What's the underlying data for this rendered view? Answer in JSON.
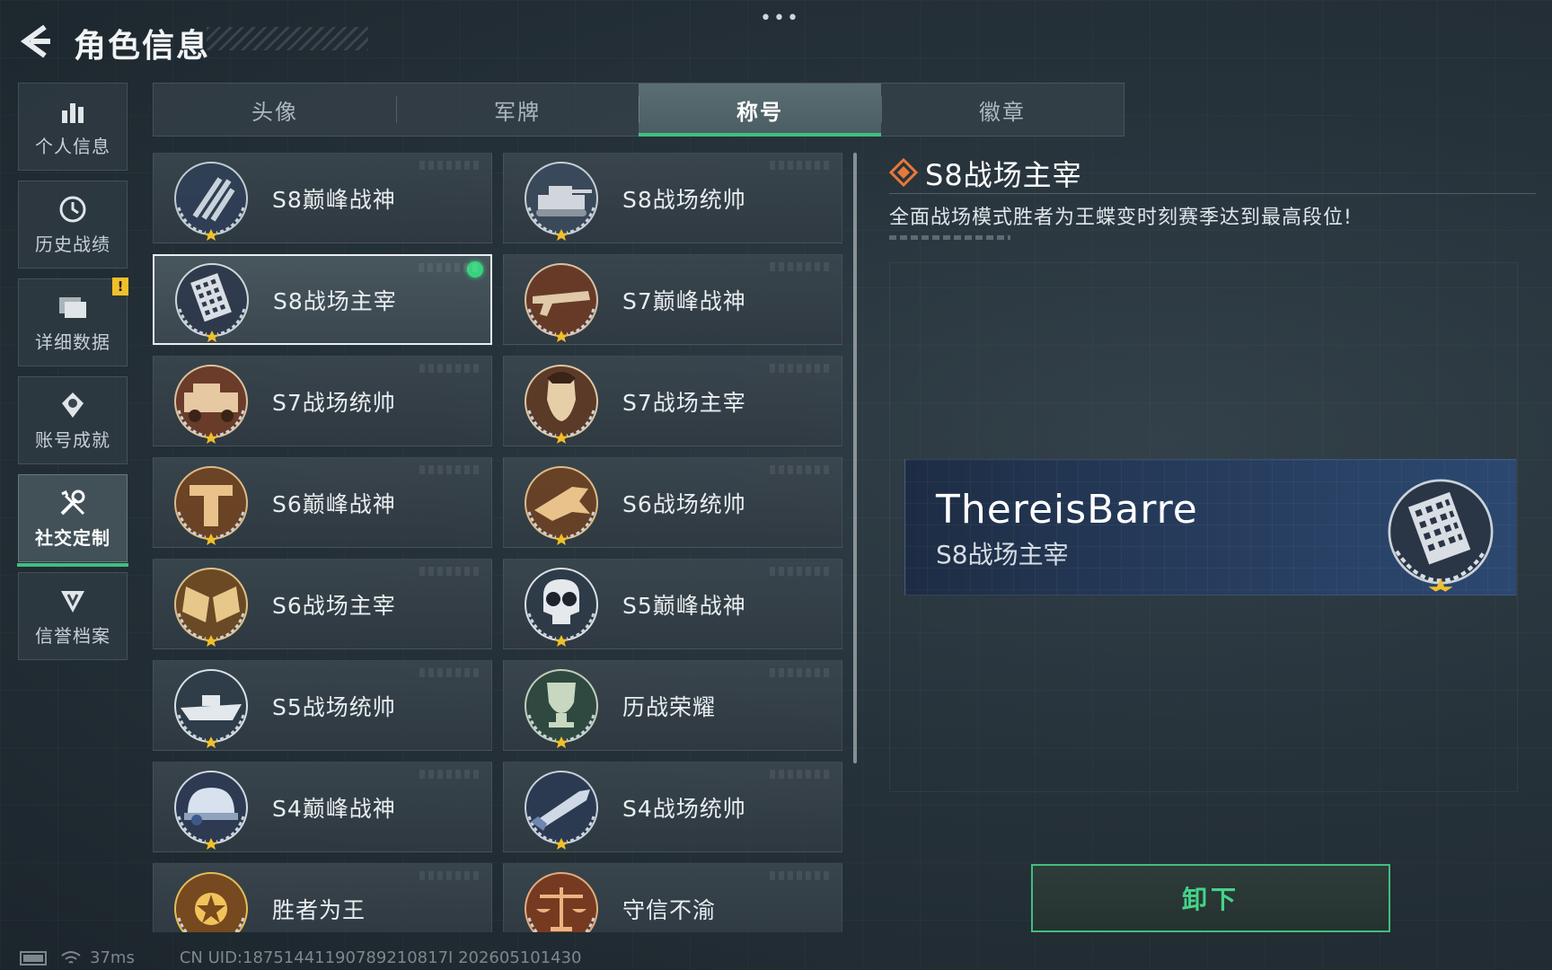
{
  "header": {
    "title": "角色信息",
    "back_icon": "back-arrow-icon",
    "more_label": "•••"
  },
  "sidebar": {
    "items": [
      {
        "label": "个人信息",
        "icon": "bar-chart-icon",
        "active": false,
        "badge": ""
      },
      {
        "label": "历史战绩",
        "icon": "clock-icon",
        "active": false,
        "badge": ""
      },
      {
        "label": "详细数据",
        "icon": "folder-icon",
        "active": false,
        "badge": "!"
      },
      {
        "label": "账号成就",
        "icon": "achievement-icon",
        "active": false,
        "badge": ""
      },
      {
        "label": "社交定制",
        "icon": "tools-icon",
        "active": true,
        "badge": ""
      },
      {
        "label": "信誉档案",
        "icon": "shield-icon",
        "active": false,
        "badge": ""
      }
    ]
  },
  "tabs": [
    {
      "label": "头像",
      "active": false
    },
    {
      "label": "军牌",
      "active": false
    },
    {
      "label": "称号",
      "active": true
    },
    {
      "label": "徽章",
      "active": false
    }
  ],
  "titles": [
    {
      "label": "S8巅峰战神",
      "emblem": "stripes-emblem",
      "selected": false,
      "equipped": false
    },
    {
      "label": "S8战场统帅",
      "emblem": "tank-emblem",
      "selected": false,
      "equipped": false
    },
    {
      "label": "S8战场主宰",
      "emblem": "building-emblem",
      "selected": true,
      "equipped": true
    },
    {
      "label": "S7巅峰战神",
      "emblem": "rifle-emblem",
      "selected": false,
      "equipped": false
    },
    {
      "label": "S7战场统帅",
      "emblem": "armored-truck-emblem",
      "selected": false,
      "equipped": false
    },
    {
      "label": "S7战场主宰",
      "emblem": "soldier-emblem",
      "selected": false,
      "equipped": false
    },
    {
      "label": "S6巅峰战神",
      "emblem": "t-emblem",
      "selected": false,
      "equipped": false
    },
    {
      "label": "S6战场统帅",
      "emblem": "jet-emblem",
      "selected": false,
      "equipped": false
    },
    {
      "label": "S6战场主宰",
      "emblem": "flags-emblem",
      "selected": false,
      "equipped": false
    },
    {
      "label": "S5巅峰战神",
      "emblem": "skull-emblem",
      "selected": false,
      "equipped": false
    },
    {
      "label": "S5战场统帅",
      "emblem": "boat-emblem",
      "selected": false,
      "equipped": false
    },
    {
      "label": "历战荣耀",
      "emblem": "trophy-emblem",
      "selected": false,
      "equipped": false
    },
    {
      "label": "S4巅峰战神",
      "emblem": "helmet-emblem",
      "selected": false,
      "equipped": false
    },
    {
      "label": "S4战场统帅",
      "emblem": "missile-emblem",
      "selected": false,
      "equipped": false
    },
    {
      "label": "胜者为王",
      "emblem": "medal-emblem",
      "selected": false,
      "equipped": false
    },
    {
      "label": "守信不渝",
      "emblem": "scales-emblem",
      "selected": false,
      "equipped": false
    }
  ],
  "detail": {
    "title": "S8战场主宰",
    "description": "全面战场模式胜者为王蝶变时刻赛季达到最高段位!",
    "nameplate": {
      "player_name": "ThereisBarre",
      "title": "S8战场主宰"
    },
    "unequip_label": "卸下"
  },
  "status_bar": {
    "ping": "37ms",
    "uid": "CN UID:18751441190789210817I 202605101430"
  },
  "colors": {
    "accent_green": "#3fbf7f",
    "equipped_dot": "#39d27e",
    "warning": "#f0c02a",
    "diamond": "#e8783a"
  }
}
